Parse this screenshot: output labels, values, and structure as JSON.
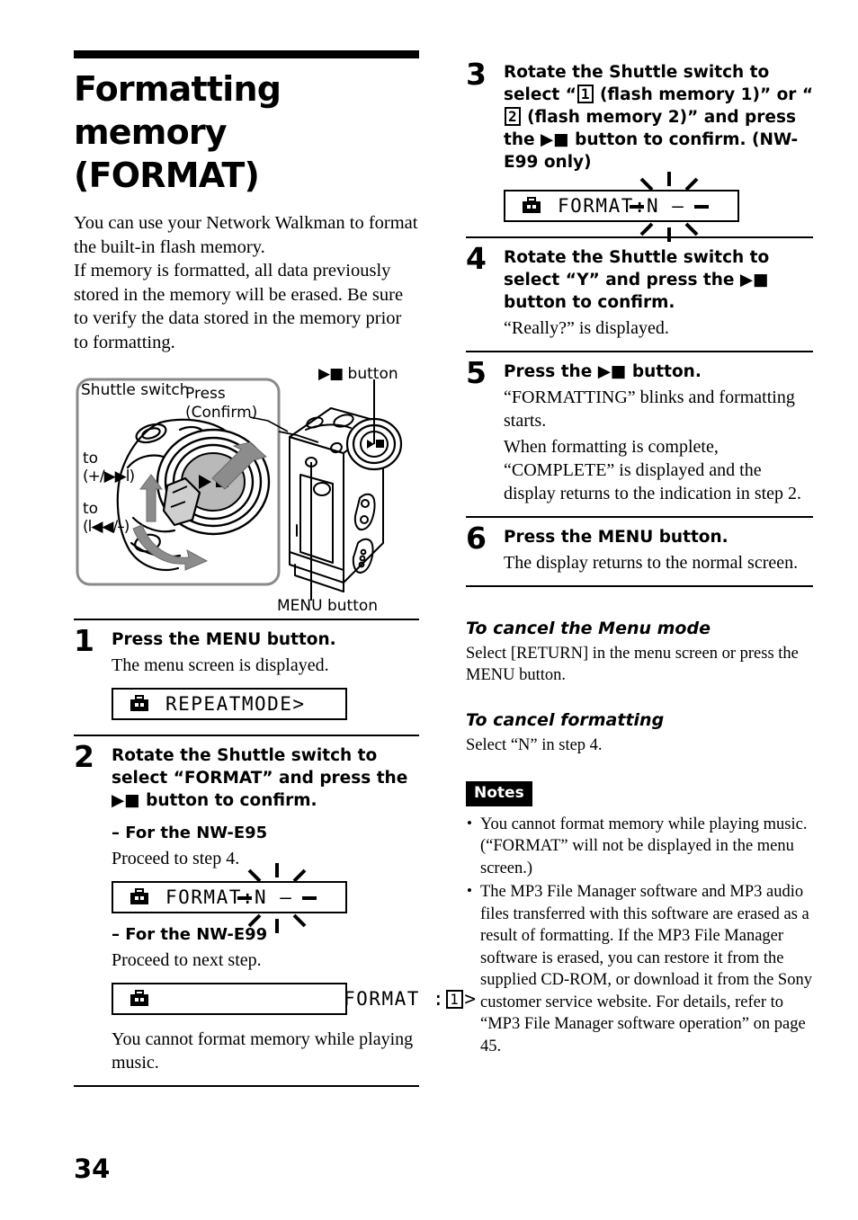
{
  "page_number": "34",
  "title": "Formatting memory (FORMAT)",
  "intro": "You can use your Network Walkman to format the built-in flash memory.\nIf memory is formatted, all data previously stored in the memory will be erased. Be sure to verify the data stored in the memory prior to formatting.",
  "figure": {
    "shuttle_switch_label": "Shuttle switch",
    "press_confirm_label": "Press\n(Confirm)",
    "to_forward_label": "to",
    "to_forward_value": "(+/▶▶l)",
    "to_back_label": "to",
    "to_back_value": "(l◀◀/–)",
    "play_stop_button_label": "button",
    "menu_button_label": "MENU button"
  },
  "steps": [
    {
      "num": "1",
      "heading": "Press the MENU button.",
      "text": "The menu screen is displayed.",
      "lcd": {
        "text": "REPEATMODE>",
        "icon": "toolbox-icon",
        "blink": false
      }
    },
    {
      "num": "2",
      "heading": "Rotate the Shuttle switch to select “FORMAT” and press the ▶■ button to confirm.",
      "sub1_head": "– For the NW-E95",
      "sub1_text": "Proceed to step 4.",
      "lcd1": {
        "text": "FORMAT:N –",
        "icon": "toolbox-icon",
        "blink": true
      },
      "sub2_head": "– For the NW-E99",
      "sub2_text": "Proceed to next step.",
      "lcd2": {
        "pre": "FORMAT :",
        "box": "1",
        "post": ">",
        "icon": "toolbox-icon",
        "blink": false
      },
      "footnote": "You cannot format memory while playing music."
    },
    {
      "num": "3",
      "heading_part1": "Rotate the Shuttle switch to select “",
      "heading_box1": "1",
      "heading_part2": " (flash memory 1)” or “",
      "heading_box2": "2",
      "heading_part3": " (flash memory 2)” and press the ▶■ button to confirm. (NW-E99 only)",
      "lcd": {
        "text": "FORMAT:N –",
        "icon": "toolbox-icon",
        "blink": true
      }
    },
    {
      "num": "4",
      "heading": "Rotate the Shuttle switch to select “Y” and press the ▶■ button to confirm.",
      "text": "“Really?” is displayed."
    },
    {
      "num": "5",
      "heading": "Press the ▶■ button.",
      "text_line1": "“FORMATTING” blinks and formatting starts.",
      "text_line2": "When formatting is complete, “COMPLETE” is displayed and the display returns to the indication in step 2."
    },
    {
      "num": "6",
      "heading": "Press the MENU button.",
      "text": "The display returns to the normal screen."
    }
  ],
  "cancel_menu": {
    "heading": "To cancel the Menu mode",
    "text": "Select [RETURN] in the menu screen or press the MENU button."
  },
  "cancel_formatting": {
    "heading": "To cancel formatting",
    "text": "Select “N” in step 4."
  },
  "notes": {
    "badge": "Notes",
    "items": [
      "You cannot format memory while playing music. (“FORMAT” will not be displayed in the menu screen.)",
      "The MP3 File Manager software and MP3 audio files transferred with this software are erased as a result of formatting. If the MP3 File Manager software is erased, you can restore it from the supplied CD-ROM, or download it from the Sony customer service website. For details, refer to “MP3 File Manager software operation” on page 45."
    ]
  }
}
